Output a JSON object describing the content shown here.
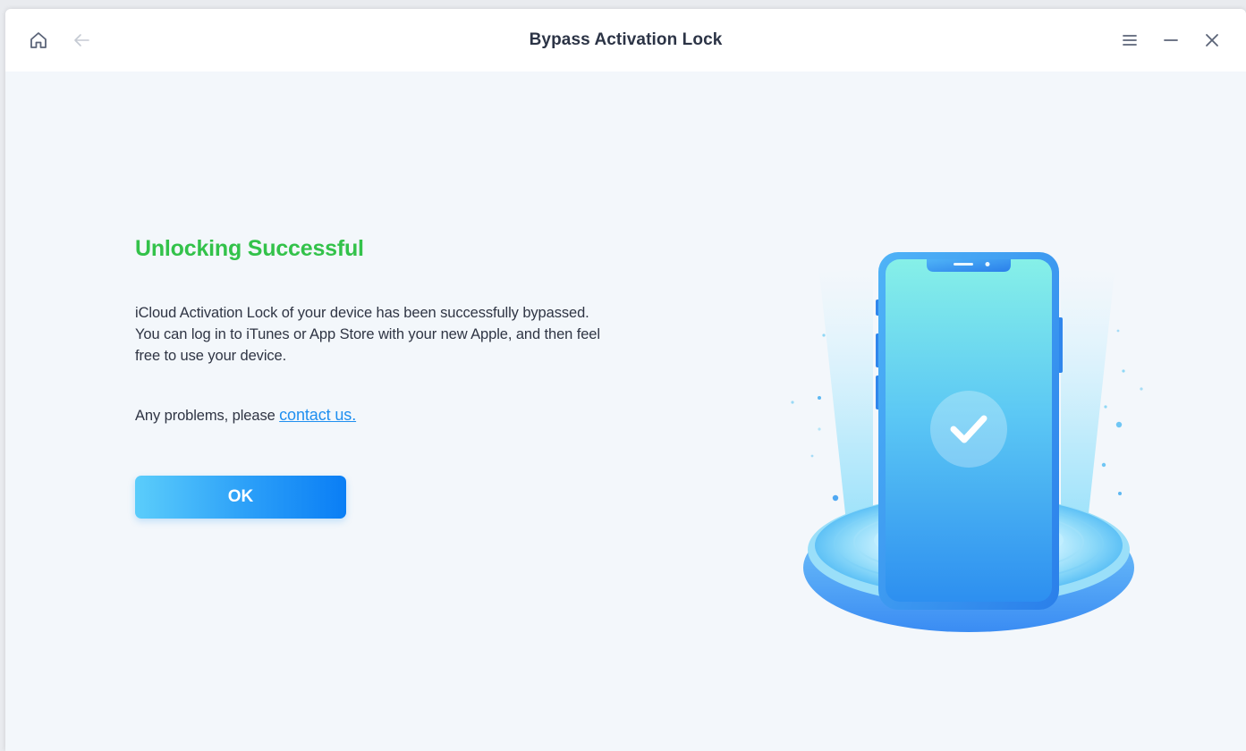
{
  "window": {
    "title": "Bypass Activation Lock"
  },
  "titlebar": {
    "home_icon": "home-icon",
    "back_icon": "arrow-left-icon",
    "menu_icon": "hamburger-menu-icon",
    "minimize_icon": "minimize-icon",
    "close_icon": "close-icon"
  },
  "main": {
    "heading": "Unlocking Successful",
    "description": "iCloud Activation Lock of your device has been successfully bypassed. You can log in to iTunes or App Store with your new Apple, and then feel free to use your device.",
    "problems_prefix": "Any problems, please ",
    "contact_link": "contact us.",
    "ok_label": "OK"
  },
  "colors": {
    "heading": "#33c24a",
    "link": "#1f8ff0",
    "button_start": "#5bcdfb",
    "button_end": "#0a7ef5",
    "background": "#f3f7fb"
  },
  "illustration": {
    "icon": "phone-check-icon"
  }
}
